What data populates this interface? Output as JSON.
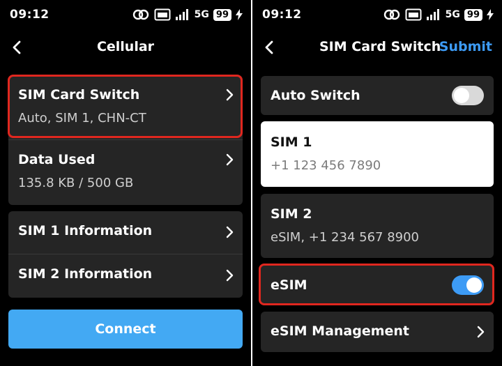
{
  "status_bar": {
    "time": "09:12",
    "network": "5G",
    "battery": "99"
  },
  "cellular": {
    "title": "Cellular",
    "sim_switch": {
      "title": "SIM Card Switch",
      "value": "Auto, SIM 1, CHN-CT"
    },
    "data_used": {
      "title": "Data Used",
      "value": "135.8 KB / 500 GB"
    },
    "sim1_info": "SIM 1 Information",
    "sim2_info": "SIM 2 Information",
    "connect_label": "Connect"
  },
  "sim_switch_page": {
    "title": "SIM Card Switch",
    "submit_label": "Submit",
    "auto_switch": {
      "label": "Auto Switch",
      "enabled": false
    },
    "sim1": {
      "title": "SIM 1",
      "number": "+1 123 456 7890",
      "selected": true
    },
    "sim2": {
      "title": "SIM 2",
      "number": "eSIM, +1 234 567 8900",
      "selected": false
    },
    "esim": {
      "label": "eSIM",
      "enabled": true
    },
    "esim_management": "eSIM Management"
  },
  "colors": {
    "accent": "#3d9bf5",
    "connect_button": "#43a9f3",
    "highlight": "#e0271f",
    "card": "#252525"
  }
}
